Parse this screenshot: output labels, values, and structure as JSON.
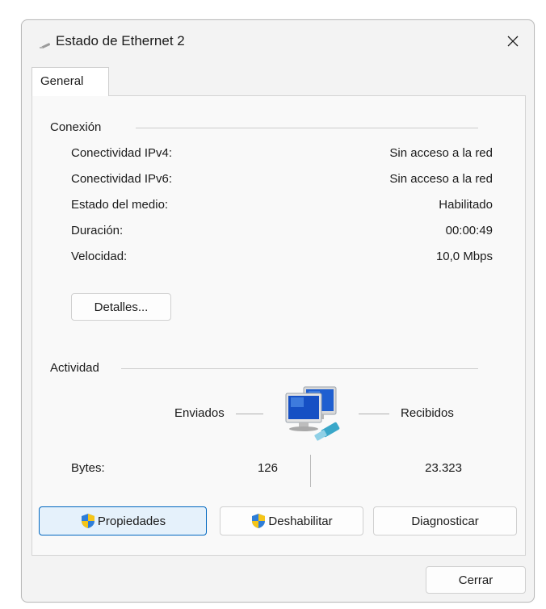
{
  "window": {
    "title": "Estado de Ethernet 2",
    "close_icon": "close-icon"
  },
  "tabs": [
    {
      "label": "General",
      "selected": true
    }
  ],
  "connection": {
    "heading": "Conexión",
    "rows": [
      {
        "label": "Conectividad IPv4:",
        "value": "Sin acceso a la red"
      },
      {
        "label": "Conectividad IPv6:",
        "value": "Sin acceso a la red"
      },
      {
        "label": "Estado del medio:",
        "value": "Habilitado"
      },
      {
        "label": "Duración:",
        "value": "00:00:49"
      },
      {
        "label": "Velocidad:",
        "value": "10,0 Mbps"
      }
    ],
    "details_button": "Detalles..."
  },
  "activity": {
    "heading": "Actividad",
    "sent_label": "Enviados",
    "received_label": "Recibidos",
    "bytes_label": "Bytes:",
    "bytes_sent": "126",
    "bytes_received": "23.323",
    "icon": "network-computers-icon"
  },
  "actions": {
    "properties": "Propiedades",
    "disable": "Deshabilitar",
    "diagnose": "Diagnosticar",
    "shield_icon": "uac-shield-icon"
  },
  "footer": {
    "close": "Cerrar"
  },
  "colors": {
    "window_bg": "#f3f3f3",
    "primary_border": "#0067c0",
    "primary_bg": "#e5f1fb"
  }
}
